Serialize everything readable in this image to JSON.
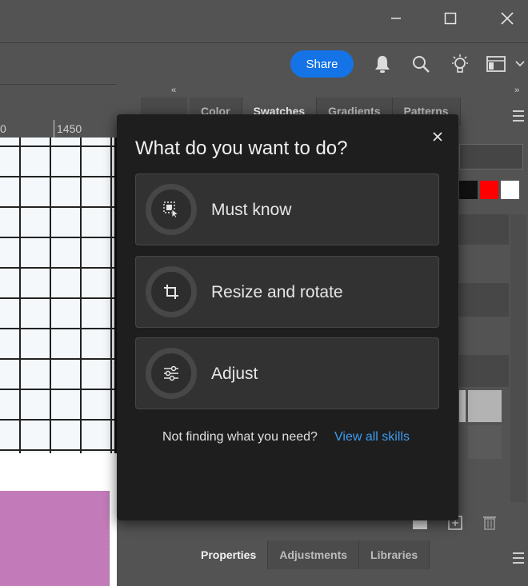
{
  "window": {
    "controls": [
      "minimize-icon",
      "maximize-icon",
      "close-icon"
    ]
  },
  "toolbar": {
    "share_label": "Share",
    "icons": [
      "bell-icon",
      "search-icon",
      "lightbulb-icon",
      "workspace-icon",
      "chevron-down-icon"
    ]
  },
  "ruler": {
    "left_label": "0",
    "right_label": "1450"
  },
  "swatches_panel": {
    "tabs": [
      {
        "label": "Color"
      },
      {
        "label": "Swatches"
      },
      {
        "label": "Gradients"
      },
      {
        "label": "Patterns"
      }
    ],
    "active_tab": "Swatches",
    "swatch_colors": [
      "#111111",
      "#ff0000",
      "#ffffff"
    ]
  },
  "properties_panel": {
    "tabs": [
      {
        "label": "Properties"
      },
      {
        "label": "Adjustments"
      },
      {
        "label": "Libraries"
      }
    ],
    "active_tab": "Properties"
  },
  "popup": {
    "title": "What do you want to do?",
    "skills": [
      {
        "label": "Must know",
        "icon": "select-cursor-icon"
      },
      {
        "label": "Resize and rotate",
        "icon": "crop-icon"
      },
      {
        "label": "Adjust",
        "icon": "sliders-icon"
      }
    ],
    "footer_text": "Not finding what you need?",
    "footer_link": "View all skills",
    "link_color": "#3b9cf0"
  },
  "colors": {
    "accent": "#1473e6",
    "popup_bg": "#1e1e1e",
    "ui_bg": "#535353"
  }
}
